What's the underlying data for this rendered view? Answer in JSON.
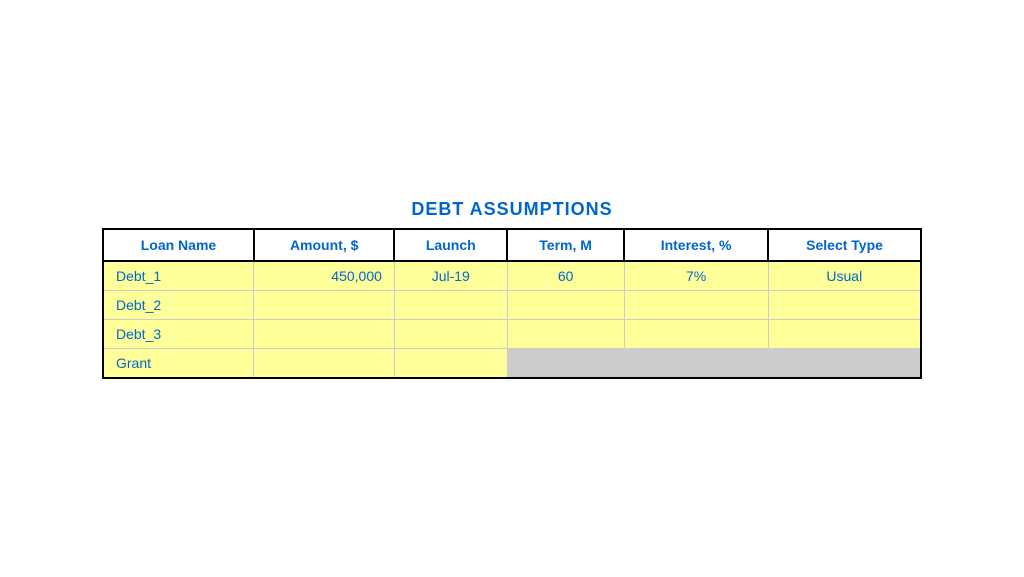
{
  "title": "DEBT ASSUMPTIONS",
  "table": {
    "headers": [
      {
        "label": "Loan Name",
        "key": "loan_name"
      },
      {
        "label": "Amount, $",
        "key": "amount"
      },
      {
        "label": "Launch",
        "key": "launch"
      },
      {
        "label": "Term, M",
        "key": "term"
      },
      {
        "label": "Interest, %",
        "key": "interest"
      },
      {
        "label": "Select Type",
        "key": "select_type"
      }
    ],
    "rows": [
      {
        "loan_name": "Debt_1",
        "amount": "450,000",
        "launch": "Jul-19",
        "term": "60",
        "interest": "7%",
        "select_type": "Usual",
        "row_type": "data"
      },
      {
        "loan_name": "Debt_2",
        "amount": "",
        "launch": "",
        "term": "",
        "interest": "",
        "select_type": "",
        "row_type": "data"
      },
      {
        "loan_name": "Debt_3",
        "amount": "",
        "launch": "",
        "term": "",
        "interest": "",
        "select_type": "",
        "row_type": "data"
      },
      {
        "loan_name": "Grant",
        "amount": "",
        "launch": "",
        "term": null,
        "interest": null,
        "select_type": null,
        "row_type": "grant"
      }
    ]
  }
}
